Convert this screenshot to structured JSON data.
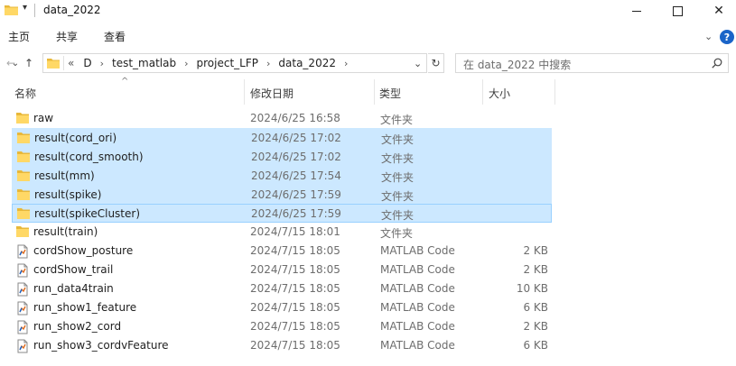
{
  "window": {
    "title": "data_2022",
    "quick_access_arrow": "▾",
    "close_glyph": "✕"
  },
  "ribbon": {
    "tabs": [
      "主页",
      "共享",
      "查看"
    ],
    "collapse_glyph": "⌄",
    "help_glyph": "?"
  },
  "nav": {
    "back_glyph": "←",
    "forward_glyph": "→",
    "recent_glyph": "⌄",
    "up_glyph": "↑",
    "overflow": "«",
    "breadcrumbs": [
      "D",
      "test_matlab",
      "project_LFP",
      "data_2022"
    ],
    "crumb_separator": "›",
    "dropdown_glyph": "⌄",
    "refresh_glyph": "↻"
  },
  "search": {
    "placeholder": "在 data_2022 中搜索"
  },
  "columns": {
    "name": "名称",
    "date": "修改日期",
    "type": "类型",
    "size": "大小",
    "sort_glyph": "^"
  },
  "files": [
    {
      "name": "raw",
      "date": "2024/6/25 16:58",
      "type": "文件夹",
      "size": "",
      "icon": "folder-icon",
      "selected": false
    },
    {
      "name": "result(cord_ori)",
      "date": "2024/6/25 17:02",
      "type": "文件夹",
      "size": "",
      "icon": "folder-icon",
      "selected": true
    },
    {
      "name": "result(cord_smooth)",
      "date": "2024/6/25 17:02",
      "type": "文件夹",
      "size": "",
      "icon": "folder-icon",
      "selected": true
    },
    {
      "name": "result(mm)",
      "date": "2024/6/25 17:54",
      "type": "文件夹",
      "size": "",
      "icon": "folder-icon",
      "selected": true
    },
    {
      "name": "result(spike)",
      "date": "2024/6/25 17:59",
      "type": "文件夹",
      "size": "",
      "icon": "folder-icon",
      "selected": true
    },
    {
      "name": "result(spikeCluster)",
      "date": "2024/6/25 17:59",
      "type": "文件夹",
      "size": "",
      "icon": "folder-icon",
      "selected": true,
      "focused": true
    },
    {
      "name": "result(train)",
      "date": "2024/7/15 18:01",
      "type": "文件夹",
      "size": "",
      "icon": "folder-icon",
      "selected": false
    },
    {
      "name": "cordShow_posture",
      "date": "2024/7/15 18:05",
      "type": "MATLAB Code",
      "size": "2 KB",
      "icon": "matlab-file-icon",
      "selected": false
    },
    {
      "name": "cordShow_trail",
      "date": "2024/7/15 18:05",
      "type": "MATLAB Code",
      "size": "2 KB",
      "icon": "matlab-file-icon",
      "selected": false
    },
    {
      "name": "run_data4train",
      "date": "2024/7/15 18:05",
      "type": "MATLAB Code",
      "size": "10 KB",
      "icon": "matlab-file-icon",
      "selected": false
    },
    {
      "name": "run_show1_feature",
      "date": "2024/7/15 18:05",
      "type": "MATLAB Code",
      "size": "6 KB",
      "icon": "matlab-file-icon",
      "selected": false
    },
    {
      "name": "run_show2_cord",
      "date": "2024/7/15 18:05",
      "type": "MATLAB Code",
      "size": "2 KB",
      "icon": "matlab-file-icon",
      "selected": false
    },
    {
      "name": "run_show3_cordvFeature",
      "date": "2024/7/15 18:05",
      "type": "MATLAB Code",
      "size": "6 KB",
      "icon": "matlab-file-icon",
      "selected": false
    }
  ],
  "colors": {
    "selection_bg": "#cce8ff",
    "selection_border": "#99d1ff",
    "folder_yellow": "#ffd866",
    "folder_dark": "#e8b83a",
    "accent_blue": "#1a64c8"
  }
}
